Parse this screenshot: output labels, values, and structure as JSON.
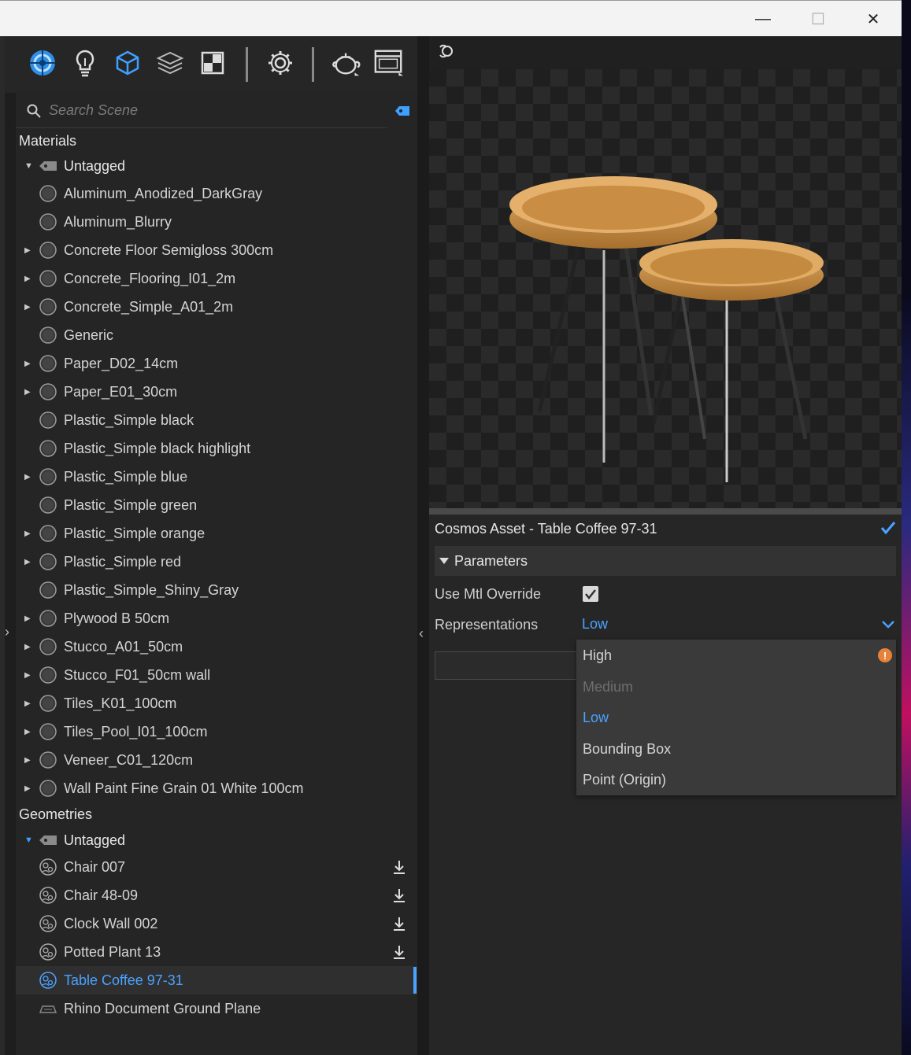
{
  "window": {
    "minimize": "—",
    "maximize": "☐",
    "close": "✕"
  },
  "toolbar": {
    "icons": [
      "materials-icon",
      "lights-icon",
      "geometry-icon",
      "layers-icon",
      "textures-icon",
      "settings-icon",
      "render-teapot-icon",
      "render-window-icon"
    ]
  },
  "search": {
    "placeholder": "Search Scene"
  },
  "materials": {
    "header": "Materials",
    "group": "Untagged",
    "items": [
      {
        "label": "Aluminum_Anodized_DarkGray",
        "expandable": false
      },
      {
        "label": "Aluminum_Blurry",
        "expandable": false
      },
      {
        "label": "Concrete Floor Semigloss 300cm",
        "expandable": true
      },
      {
        "label": "Concrete_Flooring_I01_2m",
        "expandable": true
      },
      {
        "label": "Concrete_Simple_A01_2m",
        "expandable": true
      },
      {
        "label": "Generic",
        "expandable": false
      },
      {
        "label": "Paper_D02_14cm",
        "expandable": true
      },
      {
        "label": "Paper_E01_30cm",
        "expandable": true
      },
      {
        "label": "Plastic_Simple black",
        "expandable": false
      },
      {
        "label": "Plastic_Simple black highlight",
        "expandable": false
      },
      {
        "label": "Plastic_Simple blue",
        "expandable": true
      },
      {
        "label": "Plastic_Simple green",
        "expandable": false
      },
      {
        "label": "Plastic_Simple orange",
        "expandable": true
      },
      {
        "label": "Plastic_Simple red",
        "expandable": true
      },
      {
        "label": "Plastic_Simple_Shiny_Gray",
        "expandable": false
      },
      {
        "label": "Plywood B 50cm",
        "expandable": true
      },
      {
        "label": "Stucco_A01_50cm",
        "expandable": true
      },
      {
        "label": "Stucco_F01_50cm wall",
        "expandable": true
      },
      {
        "label": "Tiles_K01_100cm",
        "expandable": true
      },
      {
        "label": "Tiles_Pool_I01_100cm",
        "expandable": true
      },
      {
        "label": "Veneer_C01_120cm",
        "expandable": true
      },
      {
        "label": "Wall Paint Fine Grain 01 White 100cm",
        "expandable": true
      }
    ]
  },
  "geometries": {
    "header": "Geometries",
    "group": "Untagged",
    "items": [
      {
        "label": "Chair 007",
        "download": true
      },
      {
        "label": "Chair 48-09",
        "download": true
      },
      {
        "label": "Clock Wall 002",
        "download": true
      },
      {
        "label": "Potted Plant 13",
        "download": true
      },
      {
        "label": "Table Coffee 97-31",
        "download": false,
        "selected": true
      },
      {
        "label": "Rhino Document Ground Plane",
        "download": false,
        "ground": true
      }
    ]
  },
  "properties": {
    "title": "Cosmos Asset - Table Coffee 97-31",
    "section": "Parameters",
    "use_mtl_override_label": "Use Mtl Override",
    "use_mtl_override": true,
    "representations_label": "Representations",
    "representations_value": "Low",
    "options": [
      {
        "label": "High",
        "state": "warning"
      },
      {
        "label": "Medium",
        "state": "disabled"
      },
      {
        "label": "Low",
        "state": "selected"
      },
      {
        "label": "Bounding Box",
        "state": "normal"
      },
      {
        "label": "Point (Origin)",
        "state": "normal"
      }
    ]
  },
  "colors": {
    "accent": "#4aa3ff",
    "warning": "#e8823a",
    "panel": "#252525",
    "text": "#d4d4d4"
  }
}
